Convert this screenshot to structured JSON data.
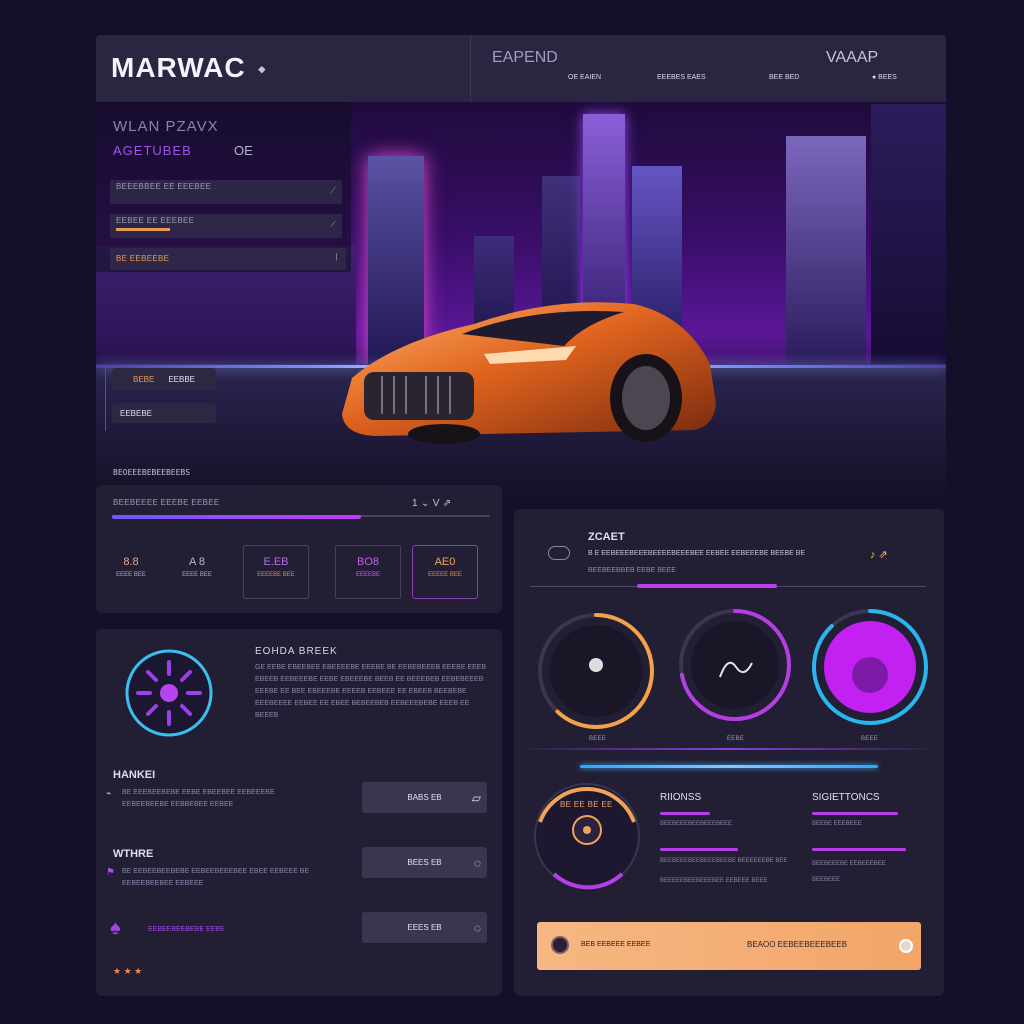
{
  "header": {
    "brand": "MARWAC",
    "brand_mark": "◆",
    "section_a": "EAPEND",
    "section_b": "VAAAP",
    "nav": [
      "OE EAIEN",
      "EEEBES EAES",
      "BEE BED",
      "● BEES"
    ]
  },
  "left_nav": {
    "title": "WLAN PZAVX",
    "subtitle": "AGETUBEB",
    "subtitle_badge": "OE",
    "items": [
      "BEEEBBEE EE EEEBEE",
      "EEBEE EE EEEBEE",
      "BE EEBEEBE"
    ],
    "chips": [
      "BEBE",
      "EEBBE",
      "EEBEBE"
    ]
  },
  "stats": {
    "section_title": "BEOEEEBEBEEBEEBS",
    "progress_label": "BEEBEEEE EEEBE EEBEE",
    "progress_value": 0.66,
    "right_mark": "1 ⌄ V ⇗",
    "cards": [
      {
        "value": "8.8",
        "label": "EEEE\nBEE"
      },
      {
        "value": "A 8",
        "label": "EEEE\nBEE"
      },
      {
        "value": "E.EB",
        "label": "EEEEBE\nBEE"
      },
      {
        "value": "BO8",
        "label": "EEEEBE"
      },
      {
        "value": "AE0",
        "label": "EEEEE\nBEE"
      }
    ]
  },
  "info": {
    "title": "EOHDA BREEK",
    "paragraph": "GE EEBE EBEEBEE EBEEEEBE EEEBE BE EEBEBEEEB EEEBE EEEB EBEEB EEBEEEBE EEBE EBEEEBE BEEB EE BEEEBEB EEBEBEEEB EEEBE EE BEE EBEEEBE EEEEB EEBEEE EE EBEEB BEEBEBE EEEBEEEE EEBEE EE EBEE BEBEEBEB EEBEEEBEBE EEEB EE BEEEB",
    "rows": [
      {
        "title": "HANKEI",
        "text": "BE EEEBEEBEBE EEBE EBEEBEE EEBEEEBE EEBEEBEEBE EEBBEBEE EEBEE",
        "button": "BABS EB"
      },
      {
        "title": "WTHRE",
        "text": "BE EEBEEBEEBEBE EEBEEBEEEBEE EBEE EEBEEE BE EEBEEBEEBEE EEBEEE",
        "button": "BEES EB"
      },
      {
        "title": "",
        "text": "EEBEEBEEBEBE EEBE",
        "button": "EEES EB"
      }
    ],
    "rating": "★ ★ ★"
  },
  "gauges": {
    "title": "ZCAET",
    "desc": "B E EEBEEEBEEEBEEEEBEEEBEE EEBEE EEBEEEBE BEEBE BE",
    "subtitle": "BEEBEEBBEB EEBE BEEE",
    "arrow": "♪ ⇗",
    "dial_labels": [
      "BEEE",
      "EEBE",
      "BEEE"
    ],
    "dials": [
      {
        "level": 0.62,
        "color": "#f4a24a"
      },
      {
        "level": 0.72,
        "color": "#b43ee0"
      },
      {
        "level": 0.88,
        "color": "#28b6ec"
      }
    ],
    "speed_label": "BE EE BE EE",
    "col_a_title": "RIIONSS",
    "col_a_lines": [
      "BEEBEEEBEEBEEEBEEE",
      "BEEBEEEBEEBEEEBEEBE BEEEEEEBE BEE",
      "BEEEEEBEEBEEEBEE EEBEEE BEEE"
    ],
    "col_b_title": "SIGIETTONCS",
    "col_b_lines": [
      "BEEBE EEEBEEE",
      "BEEBEEEBE EEBEEEBEE",
      "BEEBEEE"
    ],
    "cta_left": "BEB EEBEEE EEBEE",
    "cta_right": "BEAOO EEBEEBEEEBEEB"
  },
  "colors": {
    "orange": "#f0a05a",
    "purple": "#b138ee",
    "blue": "#2c9bf0",
    "panel": "#242034"
  },
  "icons": [
    "diamond-icon",
    "chevron-icon",
    "cursor-icon",
    "close-icon",
    "bolt-icon",
    "pin-icon",
    "star-icon"
  ]
}
